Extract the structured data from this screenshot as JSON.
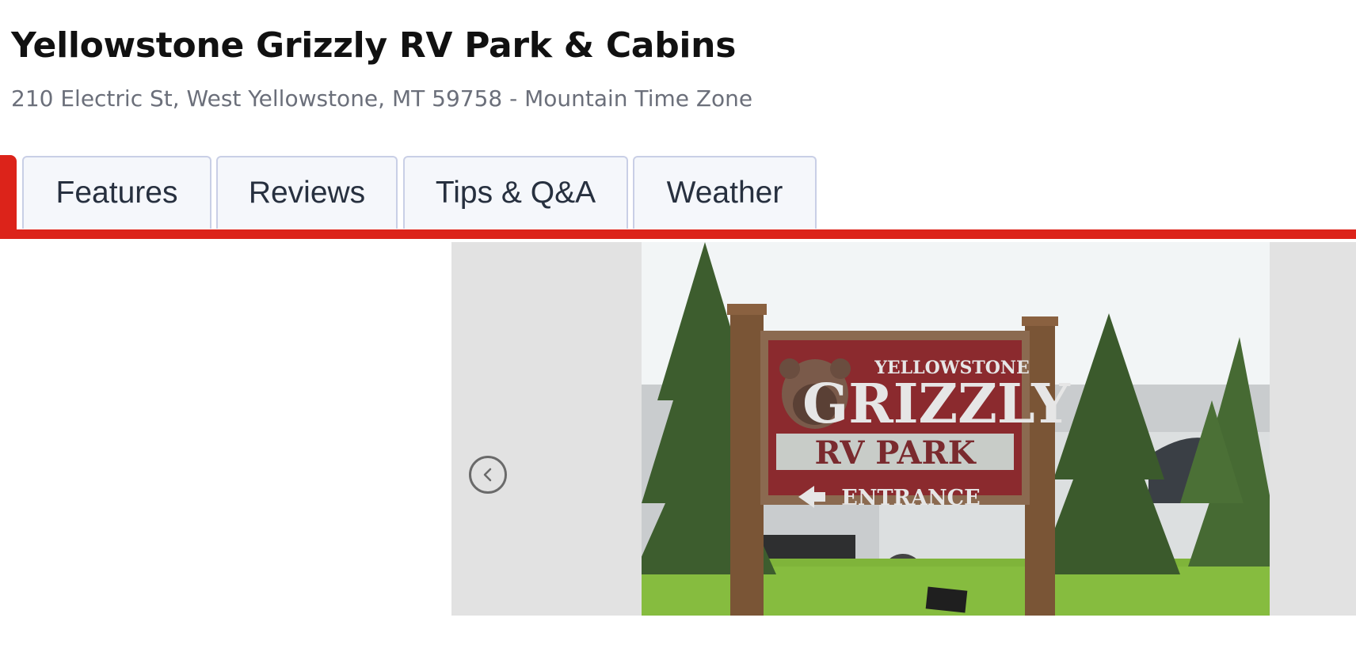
{
  "header": {
    "title": "Yellowstone Grizzly RV Park & Cabins",
    "address": "210 Electric St, West Yellowstone, MT 59758 - Mountain Time Zone"
  },
  "tabs": [
    {
      "label": "Features"
    },
    {
      "label": "Reviews"
    },
    {
      "label": "Tips & Q&A"
    },
    {
      "label": "Weather"
    }
  ],
  "gallery": {
    "prev_icon": "chevron-left-icon",
    "photo_sign": {
      "line1": "YELLOWSTONE",
      "line2": "GRIZZLY",
      "line3": "RV PARK",
      "line4": "ENTRANCE"
    }
  },
  "colors": {
    "accent": "#dc231a",
    "tab_bg": "#f5f7fb",
    "tab_border": "#c9cfe6",
    "gallery_bg": "#e2e2e2"
  }
}
